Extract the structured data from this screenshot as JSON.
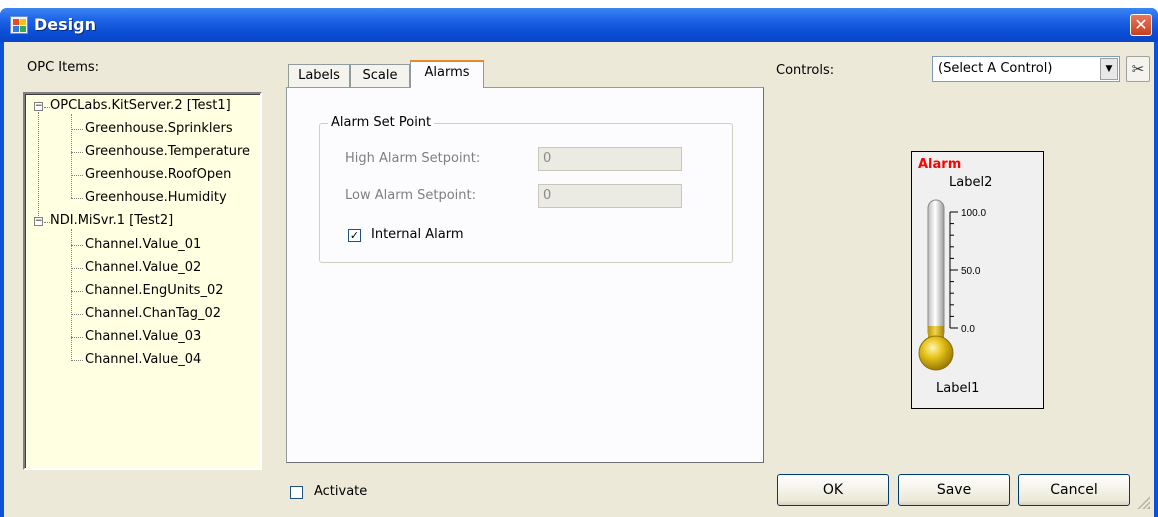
{
  "window": {
    "title": "Design",
    "close_glyph": "✕"
  },
  "opc_items_label": "OPC Items:",
  "tree": [
    {
      "label": "OPCLabs.KitServer.2 [Test1]",
      "children": [
        "Greenhouse.Sprinklers",
        "Greenhouse.Temperature",
        "Greenhouse.RoofOpen",
        "Greenhouse.Humidity"
      ]
    },
    {
      "label": "NDI.MiSvr.1 [Test2]",
      "children": [
        "Channel.Value_01",
        "Channel.Value_02",
        "Channel.EngUnits_02",
        "Channel.ChanTag_02",
        "Channel.Value_03",
        "Channel.Value_04"
      ]
    }
  ],
  "tabs": [
    "Labels",
    "Scale",
    "Alarms"
  ],
  "active_tab": "Alarms",
  "alarm_group": {
    "title": "Alarm Set Point",
    "high_label": "High Alarm Setpoint:",
    "high_value": "0",
    "low_label": "Low Alarm Setpoint:",
    "low_value": "0",
    "internal_label": "Internal Alarm",
    "internal_checked": true,
    "check_glyph": "✓"
  },
  "activate": {
    "label": "Activate",
    "checked": false
  },
  "controls": {
    "label": "Controls:",
    "selected": "(Select A Control)",
    "arrow_glyph": "▼",
    "cut_glyph": "✂"
  },
  "preview": {
    "alarm": "Alarm",
    "top_label": "Label2",
    "bottom_label": "Label1",
    "ticks": [
      "100.0",
      "50.0",
      "0.0"
    ],
    "fill_fraction": 0.0,
    "alarm_color": "#ff0000",
    "bulb_color": "#e6c21a"
  },
  "buttons": {
    "ok": "OK",
    "save": "Save",
    "cancel": "Cancel"
  }
}
